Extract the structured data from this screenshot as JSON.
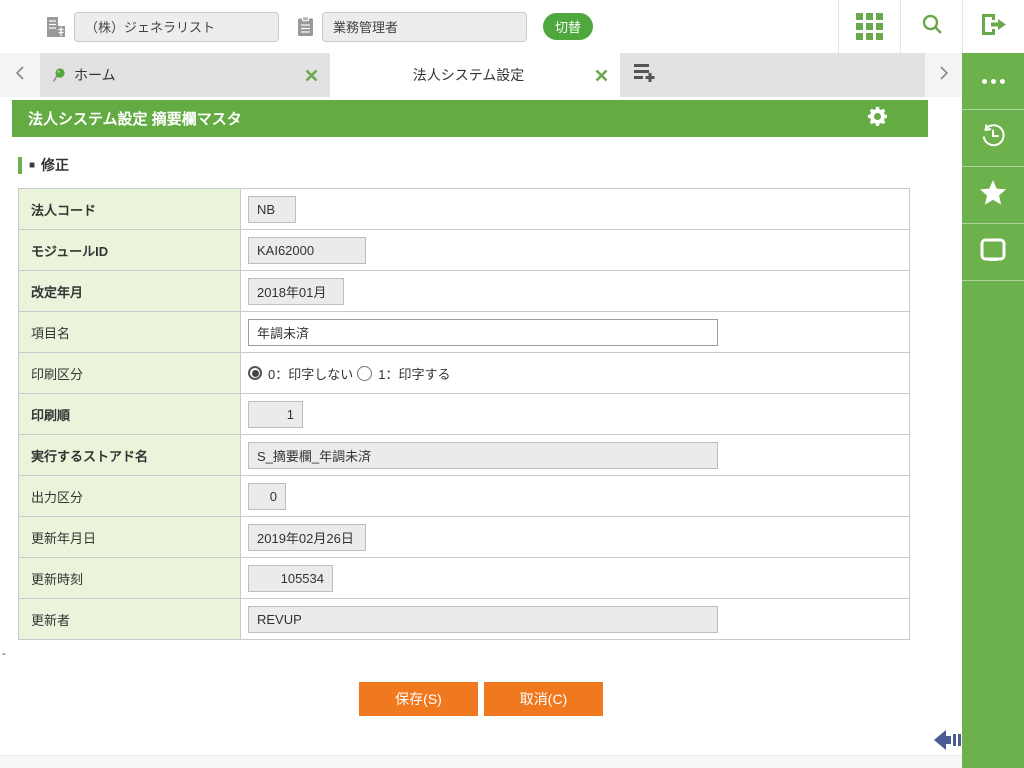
{
  "header": {
    "company_field": {
      "value": "（株）ジェネラリスト"
    },
    "role_field": {
      "value": "業務管理者"
    },
    "switch_button": "切替"
  },
  "tab_bar": {
    "tabs": [
      {
        "label": "ホーム",
        "active": false,
        "pinned": true
      },
      {
        "label": "法人システム設定",
        "active": true,
        "pinned": false
      }
    ]
  },
  "main": {
    "title": "法人システム設定 摘要欄マスタ",
    "section_marker": "■",
    "section_title": "修正",
    "corner_dash": "-"
  },
  "form": {
    "rows": [
      {
        "label": "法人コード",
        "value": "NB"
      },
      {
        "label": "モジュールID",
        "value": "KAI62000"
      },
      {
        "label": "改定年月",
        "value": "2018年01月"
      },
      {
        "label": "項目名",
        "value": "年調未済"
      },
      {
        "label": "印刷区分"
      },
      {
        "label": "印刷順",
        "value": "1"
      },
      {
        "label": "実行するストアド名",
        "value": "S_摘要欄_年調未済"
      },
      {
        "label": "出力区分",
        "value": "0"
      },
      {
        "label": "更新年月日",
        "value": "2019年02月26日"
      },
      {
        "label": "更新時刻",
        "value": "105534"
      },
      {
        "label": "更新者",
        "value": "REVUP"
      }
    ],
    "print_radio": {
      "options": [
        {
          "label": "0：印字しない",
          "selected": true
        },
        {
          "label": "1：印字する",
          "selected": false
        }
      ]
    }
  },
  "actions": {
    "save": "保存(S)",
    "cancel": "取消(C)"
  },
  "icons": [
    "building-icon",
    "clipboard-icon",
    "apps-grid-icon",
    "search-icon",
    "logout-icon",
    "back-chevron-icon",
    "forward-chevron-icon",
    "pin-icon",
    "close-icon",
    "add-tab-icon",
    "more-dots-icon",
    "history-icon",
    "star-icon",
    "feedback-bubble-icon",
    "gear-icon",
    "collapse-arrow-icon"
  ],
  "colors": {
    "green_main": "#64ab44",
    "green_sidebar": "#6cb14c",
    "green_button": "#4fa83e",
    "orange_action": "#f0781f",
    "label_bg": "#e9f4da",
    "arrow_blue": "#4c5b94"
  }
}
